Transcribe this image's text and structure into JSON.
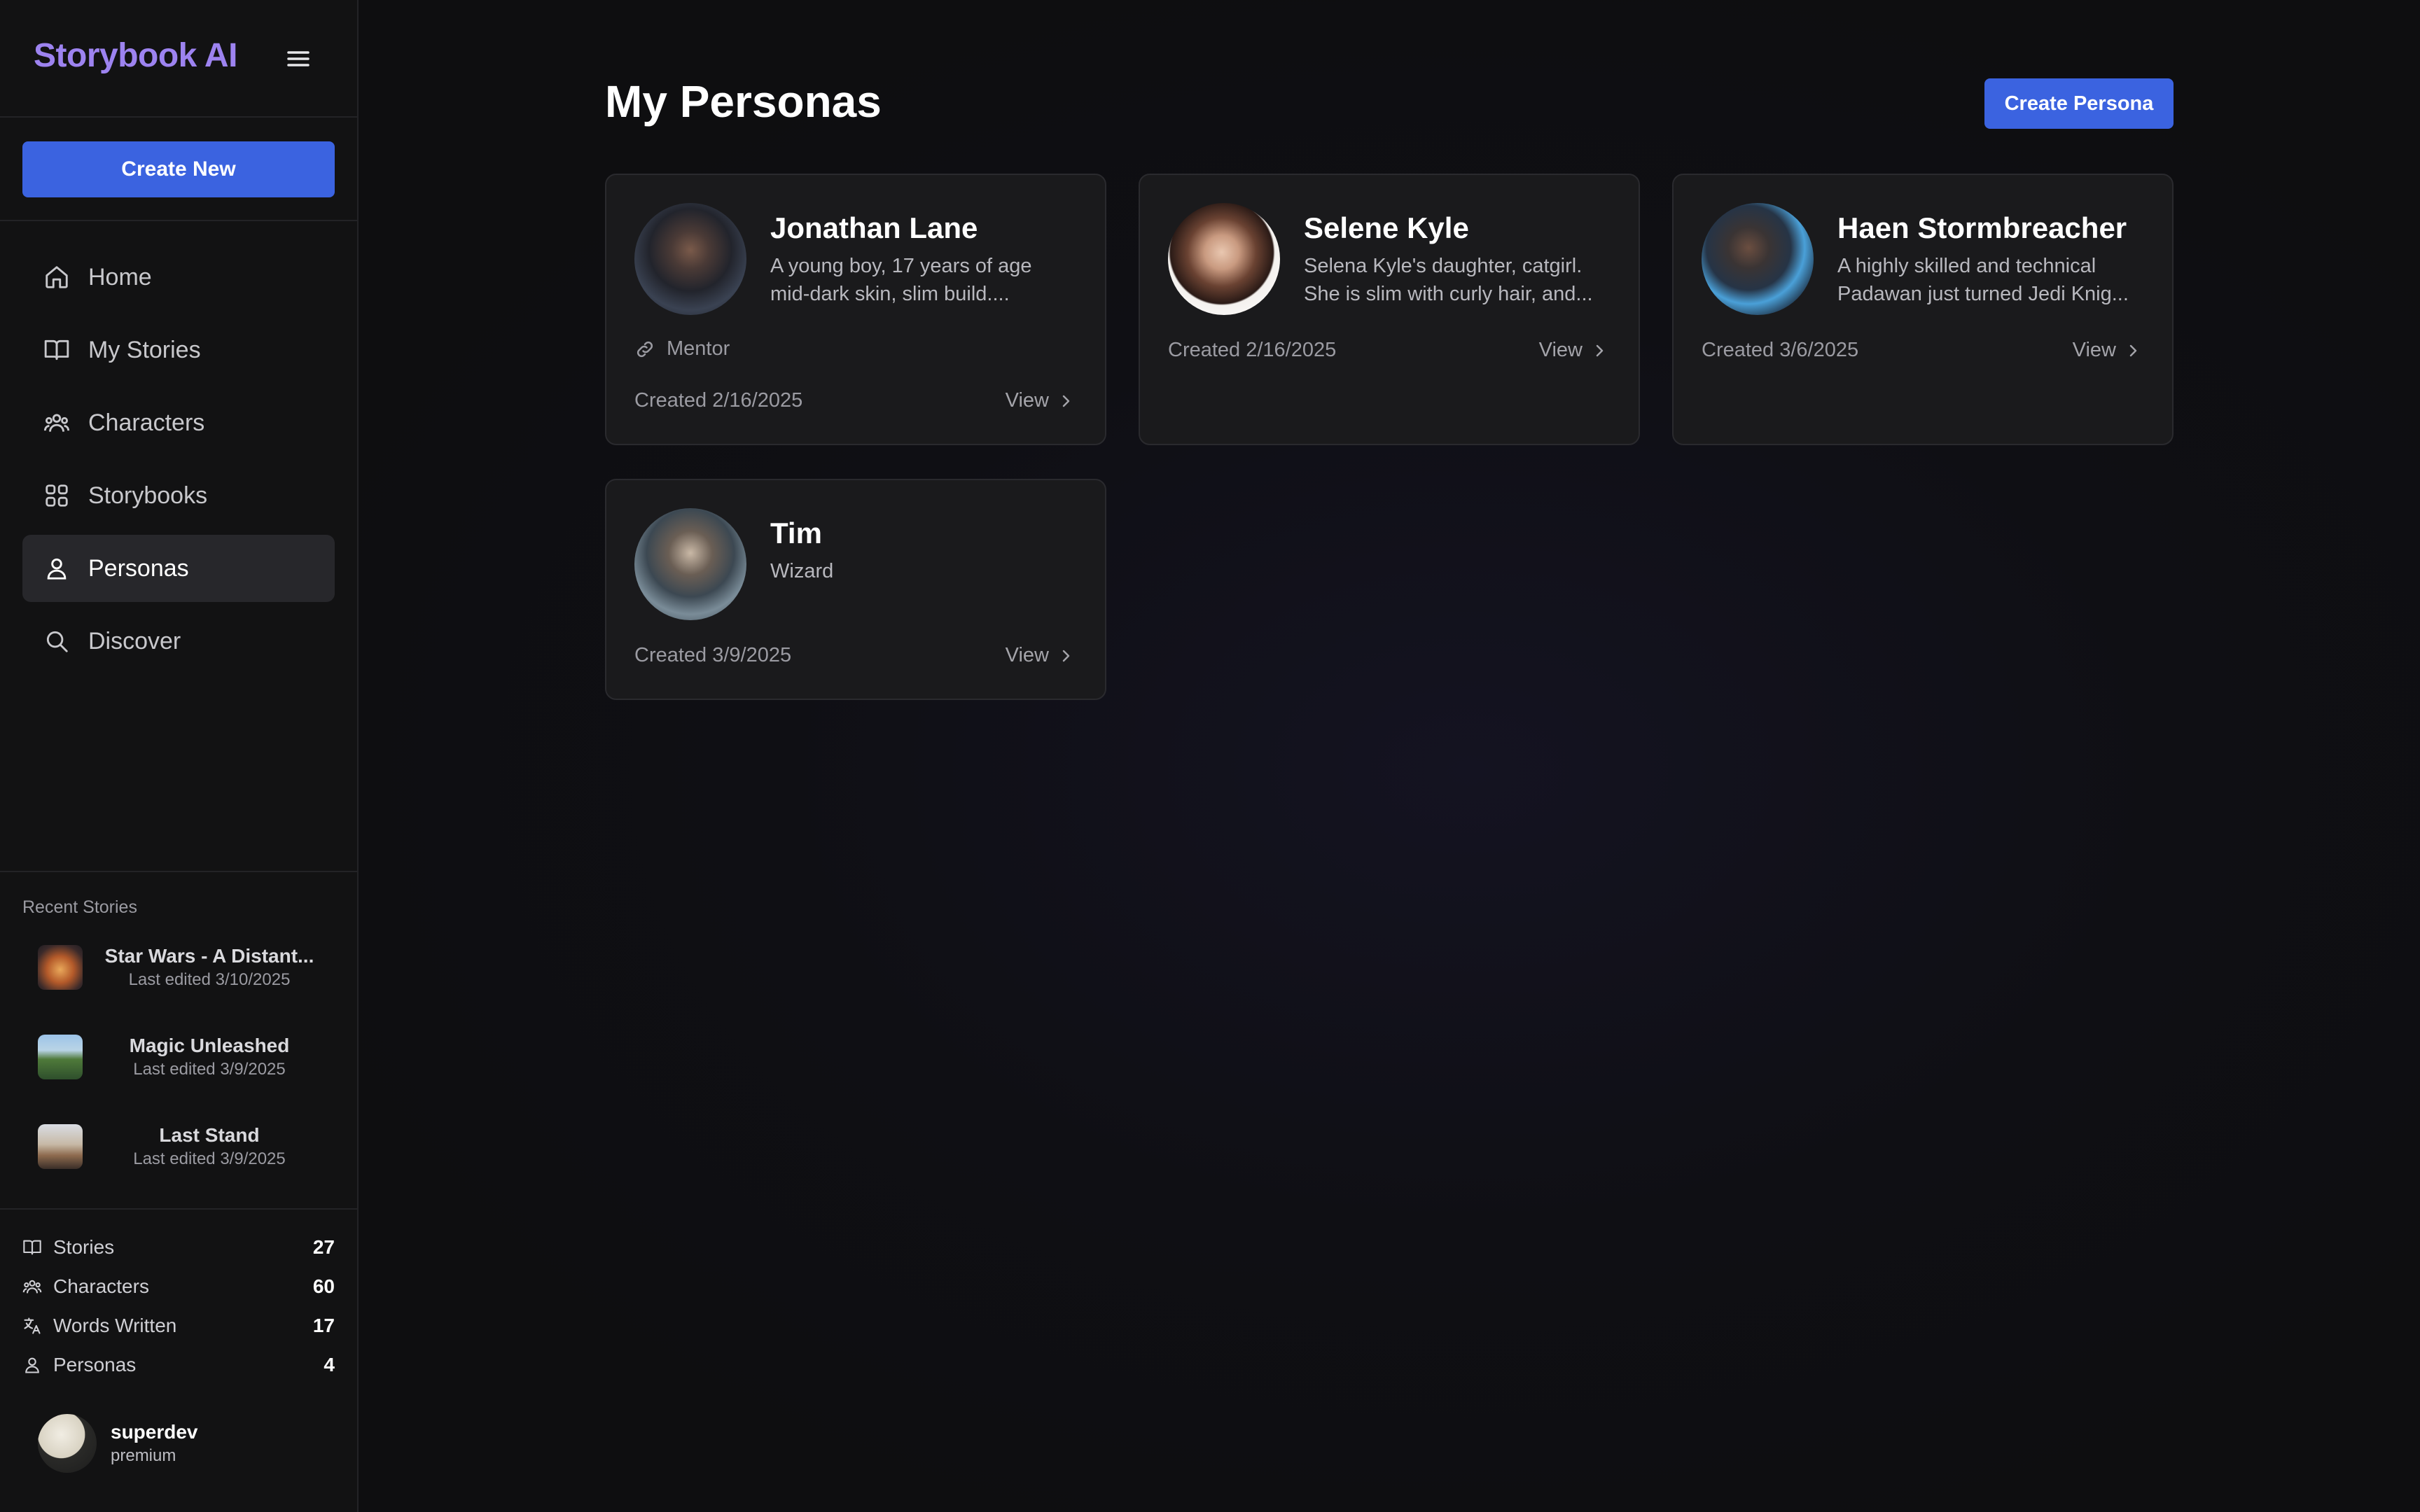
{
  "sidebar": {
    "brand": "Storybook AI",
    "create_label": "Create New",
    "nav": [
      {
        "label": "Home",
        "icon": "home-icon"
      },
      {
        "label": "My Stories",
        "icon": "book-icon"
      },
      {
        "label": "Characters",
        "icon": "users-icon"
      },
      {
        "label": "Storybooks",
        "icon": "grid-icon"
      },
      {
        "label": "Personas",
        "icon": "user-icon",
        "active": true
      },
      {
        "label": "Discover",
        "icon": "search-icon"
      }
    ],
    "recent_title": "Recent Stories",
    "recent": [
      {
        "title": "Star Wars - A Distant...",
        "edited": "Last edited 3/10/2025"
      },
      {
        "title": "Magic Unleashed",
        "edited": "Last edited 3/9/2025"
      },
      {
        "title": "Last Stand",
        "edited": "Last edited 3/9/2025"
      }
    ],
    "stats": [
      {
        "label": "Stories",
        "value": "27"
      },
      {
        "label": "Characters",
        "value": "60"
      },
      {
        "label": "Words Written",
        "value": "17"
      },
      {
        "label": "Personas",
        "value": "4"
      }
    ],
    "user": {
      "name": "superdev",
      "tier": "premium"
    }
  },
  "main": {
    "title": "My Personas",
    "create_label": "Create Persona",
    "personas": [
      {
        "name": "Jonathan Lane",
        "desc1": "A young boy, 17 years of age",
        "desc2": "mid-dark skin, slim build....",
        "tag": "Mentor",
        "created": "Created 2/16/2025",
        "view": "View"
      },
      {
        "name": "Selene Kyle",
        "desc1": "Selena Kyle's daughter, catgirl.",
        "desc2": "She is slim with curly hair, and...",
        "created": "Created 2/16/2025",
        "view": "View"
      },
      {
        "name": "Haen Stormbreacher",
        "desc1": "A highly skilled and technical",
        "desc2": "Padawan just turned Jedi Knig...",
        "created": "Created 3/6/2025",
        "view": "View"
      },
      {
        "name": "Tim",
        "desc1": "Wizard",
        "created": "Created 3/9/2025",
        "view": "View"
      }
    ]
  },
  "colors": {
    "accent": "#3b63e0",
    "brand": "#9d83f0",
    "background": "#0e0e10",
    "card": "#1a1a1c"
  }
}
